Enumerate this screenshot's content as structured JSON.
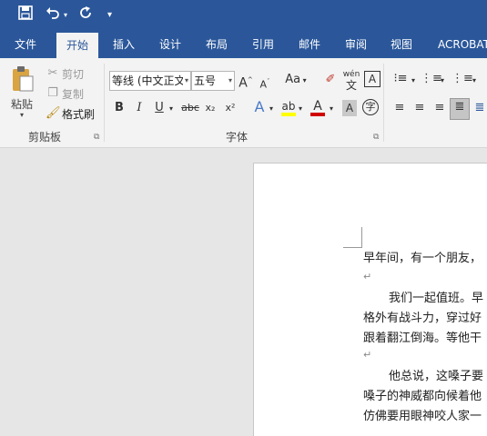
{
  "qat": {
    "save_icon": "save-icon",
    "undo_icon": "undo-icon",
    "redo_icon": "redo-icon",
    "customize_icon": "customize-qat-icon"
  },
  "tabs": [
    "文件",
    "开始",
    "插入",
    "设计",
    "布局",
    "引用",
    "邮件",
    "审阅",
    "视图",
    "ACROBAT"
  ],
  "active_tab": "开始",
  "clipboard": {
    "paste": "粘贴",
    "cut": "剪切",
    "copy": "复制",
    "format_painter": "格式刷",
    "group": "剪贴板"
  },
  "font": {
    "font_name": "等线 (中文正文)",
    "font_size": "五号",
    "aa": "Aa",
    "phonetic": "wén",
    "bold": "B",
    "italic": "I",
    "underline": "U",
    "strike": "abc",
    "sub": "x₂",
    "sup": "x²",
    "group": "字体"
  },
  "document": {
    "lines": [
      "早年间，有一个朋友，",
      "我们一起值班。早",
      "格外有战斗力，穿过好",
      "跟着翻江倒海。等他干",
      "他总说，这嗓子要",
      "嗓子的神威都向候着他",
      "仿佛要用眼神咬人家一"
    ],
    "para_mark": "↵"
  },
  "colors": {
    "brand": "#2b579a",
    "ribbon": "#f3f3f3",
    "highlight": "#ffff00",
    "font_color": "#d00000"
  }
}
